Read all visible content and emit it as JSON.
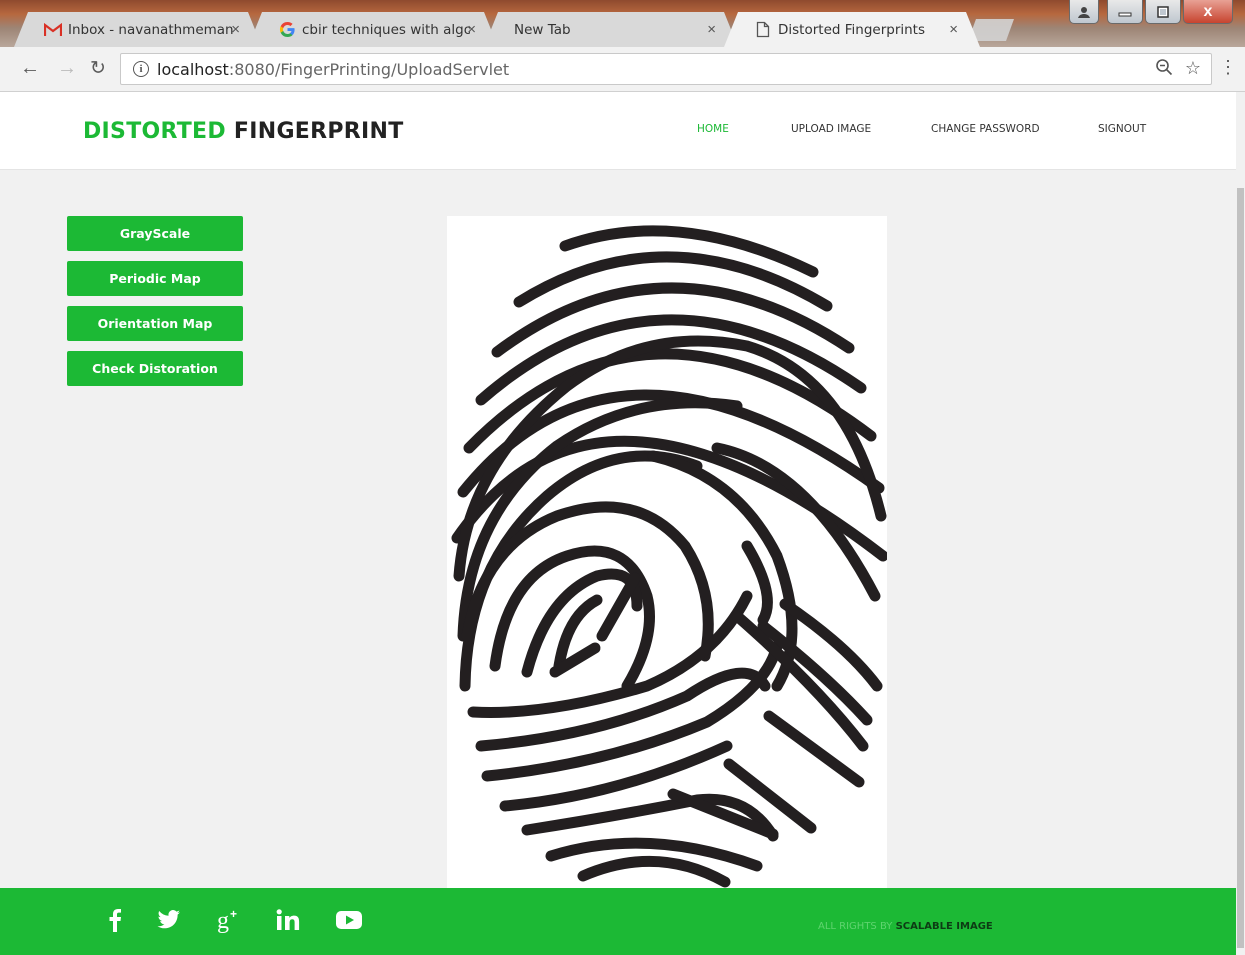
{
  "browser": {
    "tabs": [
      {
        "title": "Inbox - navanathmemane",
        "favicon": "gmail-icon",
        "close": "×"
      },
      {
        "title": "cbir techniques with algo",
        "favicon": "google-icon",
        "close": "×"
      },
      {
        "title": "New Tab",
        "favicon": "",
        "close": "×"
      },
      {
        "title": "Distorted Fingerprints",
        "favicon": "page-icon",
        "close": "×"
      }
    ],
    "url_host": "localhost",
    "url_path": ":8080/FingerPrinting/UploadServlet",
    "window_controls": {
      "close": "x"
    }
  },
  "header": {
    "brand_primary": "DISTORTED",
    "brand_secondary": "FINGERPRINT",
    "nav": [
      {
        "label": "HOME",
        "active": true
      },
      {
        "label": "UPLOAD IMAGE",
        "active": false
      },
      {
        "label": "CHANGE PASSWORD",
        "active": false
      },
      {
        "label": "SIGNOUT",
        "active": false
      }
    ]
  },
  "sidebar": {
    "buttons": [
      "GrayScale",
      "Periodic Map",
      "Orientation Map",
      "Check Distoration"
    ]
  },
  "main": {
    "image_icon": "fingerprint-image"
  },
  "footer": {
    "social_icons": [
      "facebook-icon",
      "twitter-icon",
      "google-plus-icon",
      "linkedin-icon",
      "youtube-icon"
    ],
    "copyright_prefix": "ALL RIGHTS BY",
    "copyright_brand": "SCALABLE IMAGE"
  },
  "colors": {
    "accent": "#1cb935",
    "background": "#f1f1f1",
    "header_bg": "#ffffff"
  }
}
